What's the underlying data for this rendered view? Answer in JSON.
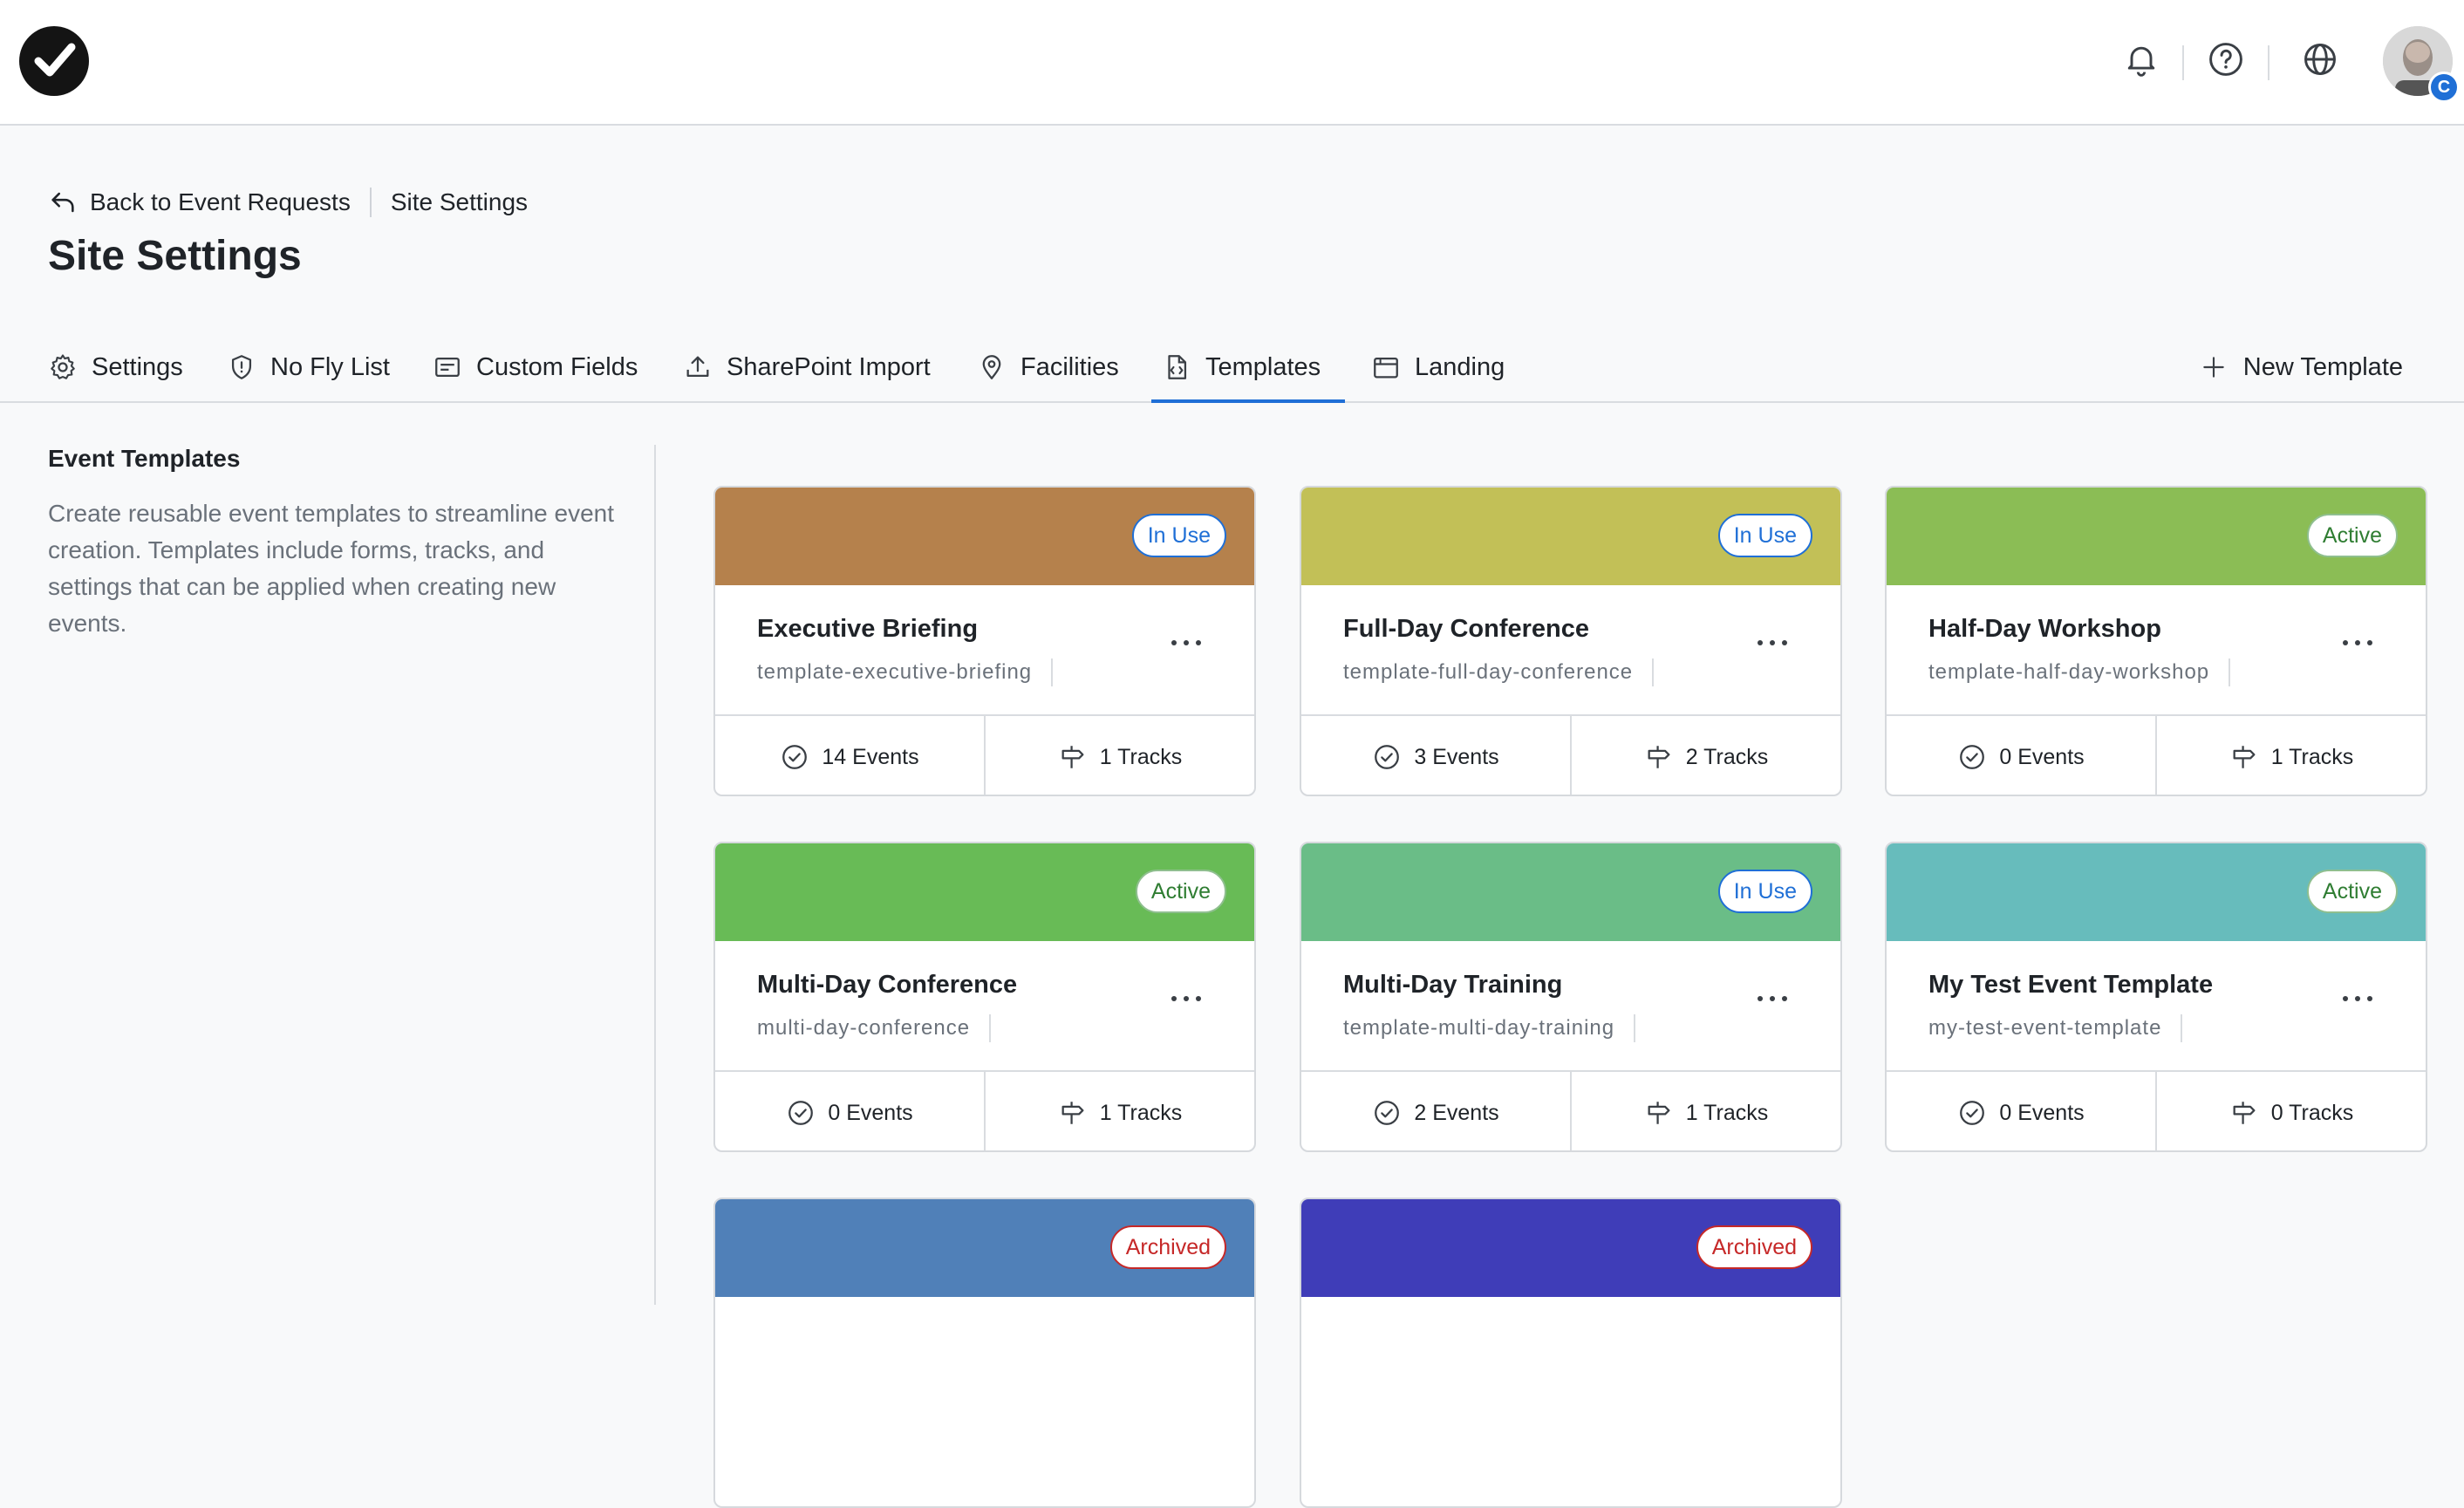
{
  "header": {
    "logo_icon": "check-circle-logo-icon",
    "icons": [
      "bell-icon",
      "help-icon",
      "globe-icon"
    ],
    "avatar_badge": "C"
  },
  "breadcrumb": {
    "back_label": "Back to Event Requests",
    "current": "Site Settings"
  },
  "page_title": "Site Settings",
  "tabs": [
    {
      "label": "Settings",
      "icon": "gear-icon"
    },
    {
      "label": "No Fly List",
      "icon": "shield-icon"
    },
    {
      "label": "Custom Fields",
      "icon": "form-icon"
    },
    {
      "label": "SharePoint Import",
      "icon": "upload-icon"
    },
    {
      "label": "Facilities",
      "icon": "location-pin-icon"
    },
    {
      "label": "Templates",
      "icon": "template-icon",
      "active": true
    },
    {
      "label": "Landing",
      "icon": "calendar-icon"
    }
  ],
  "actions": {
    "new_template": "New Template"
  },
  "sidebar": {
    "title": "Event Templates",
    "description": "Create reusable event templates to streamline event creation. Templates include forms, tracks, and settings that can be applied when creating new events."
  },
  "templates": [
    {
      "name": "Executive Briefing",
      "slug": "template-executive-briefing",
      "status": "In Use",
      "color": "#b5814c",
      "events": "14 Events",
      "tracks": "1 Tracks"
    },
    {
      "name": "Full-Day Conference",
      "slug": "template-full-day-conference",
      "status": "In Use",
      "color": "#c2c057",
      "events": "3 Events",
      "tracks": "2 Tracks"
    },
    {
      "name": "Half-Day Workshop",
      "slug": "template-half-day-workshop",
      "status": "Active",
      "color": "#8bbd55",
      "events": "0 Events",
      "tracks": "1 Tracks"
    },
    {
      "name": "Multi-Day Conference",
      "slug": "multi-day-conference",
      "status": "Active",
      "color": "#68bb56",
      "events": "0 Events",
      "tracks": "1 Tracks"
    },
    {
      "name": "Multi-Day Training",
      "slug": "template-multi-day-training",
      "status": "In Use",
      "color": "#6abd87",
      "events": "2 Events",
      "tracks": "1 Tracks"
    },
    {
      "name": "My Test Event Template",
      "slug": "my-test-event-template",
      "status": "Active",
      "color": "#67bcbc",
      "events": "0 Events",
      "tracks": "0 Tracks"
    },
    {
      "name": "",
      "slug": "",
      "status": "Archived",
      "color": "#5080b8",
      "events": "",
      "tracks": ""
    },
    {
      "name": "",
      "slug": "",
      "status": "Archived",
      "color": "#3f3db8",
      "events": "",
      "tracks": ""
    }
  ]
}
